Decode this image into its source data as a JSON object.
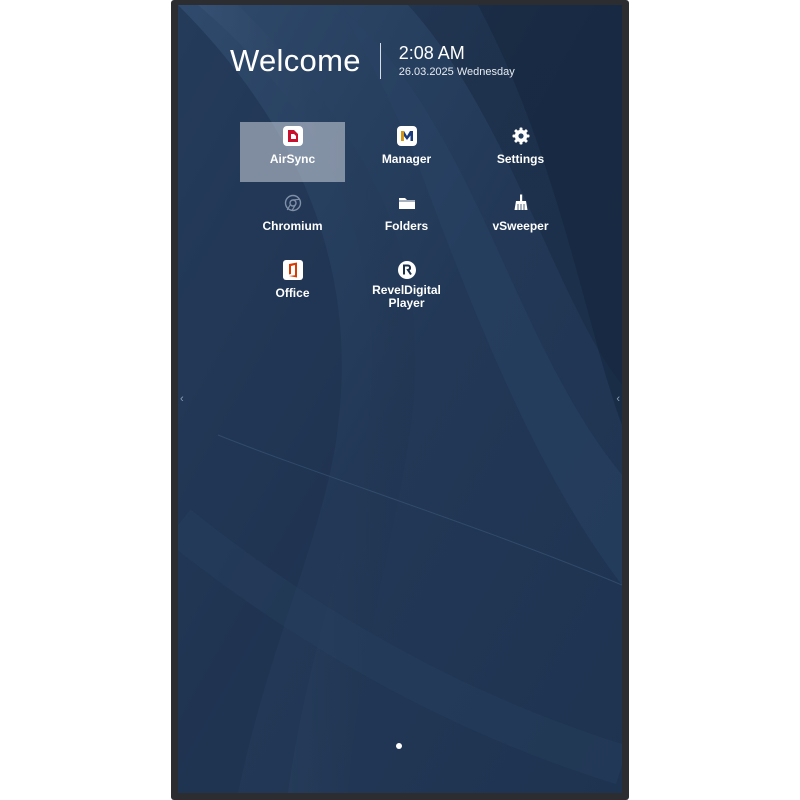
{
  "header": {
    "welcome": "Welcome",
    "time": "2:08 AM",
    "date": "26.03.2025 Wednesday"
  },
  "apps": [
    {
      "label": "AirSync",
      "icon": "airsync-icon",
      "selected": true
    },
    {
      "label": "Manager",
      "icon": "manager-icon",
      "selected": false
    },
    {
      "label": "Settings",
      "icon": "gear-icon",
      "selected": false
    },
    {
      "label": "Chromium",
      "icon": "chromium-icon",
      "selected": false
    },
    {
      "label": "Folders",
      "icon": "folder-icon",
      "selected": false
    },
    {
      "label": "vSweeper",
      "icon": "broom-icon",
      "selected": false
    },
    {
      "label": "Office",
      "icon": "office-icon",
      "selected": false
    },
    {
      "label": "RevelDigital Player",
      "icon": "reveldigital-icon",
      "selected": false
    }
  ],
  "colors": {
    "wallpaper_base": "#233955",
    "wallpaper_light": "#3a5577",
    "selection": "#cdd4de",
    "airsync_red": "#c8102e",
    "office_red": "#d83b01"
  },
  "pager": {
    "pages": 1,
    "current": 1
  }
}
